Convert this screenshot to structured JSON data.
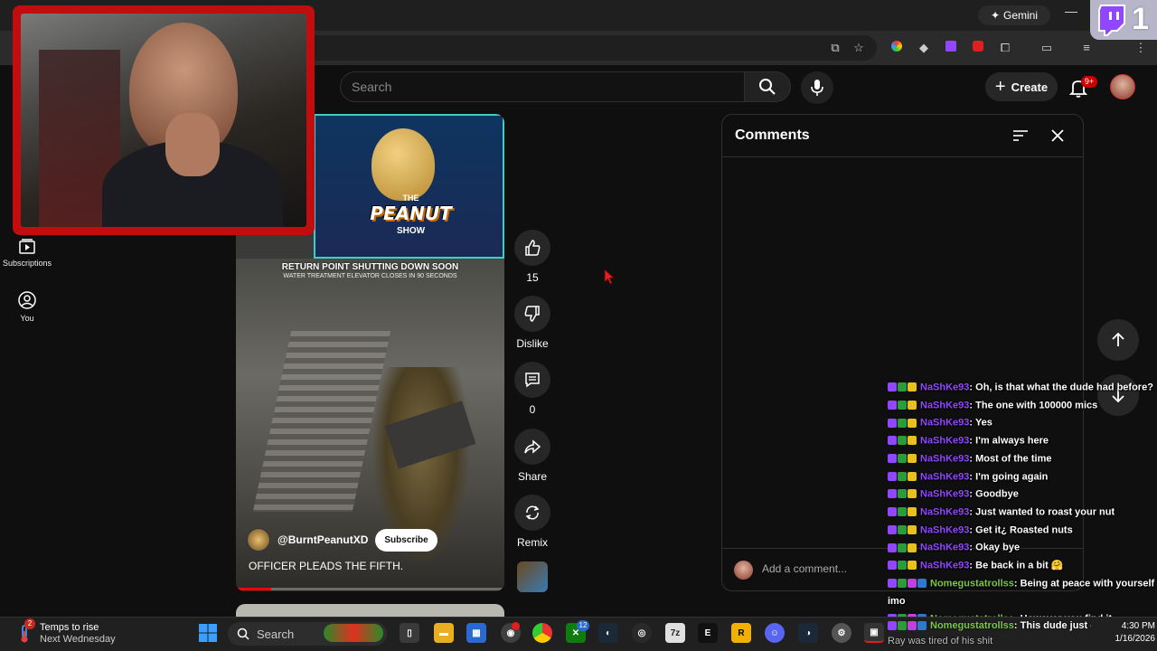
{
  "browser": {
    "gemini_label": "Gemini",
    "minimize_glyph": "—"
  },
  "twitch": {
    "viewer_count": "1"
  },
  "header": {
    "search_placeholder": "Search",
    "create_label": "Create",
    "notification_count": "9+"
  },
  "sidebar": {
    "items": [
      {
        "label": "Subscriptions",
        "icon": "subscriptions-icon"
      },
      {
        "label": "You",
        "icon": "user-icon"
      }
    ]
  },
  "video": {
    "show_top": "THE",
    "show_name": "PEANUT",
    "show_bottom": "SHOW",
    "hud_title": "RETURN POINT SHUTTING DOWN SOON",
    "hud_subtitle": "WATER TREATMENT ELEVATOR CLOSES IN 90 SECONDS",
    "channel": "@BurntPeanutXD",
    "subscribe_label": "Subscribe",
    "caption": "OFFICER PLEADS THE FIFTH.",
    "progress": 0.13
  },
  "actions": {
    "like_count": "15",
    "dislike_label": "Dislike",
    "comment_count": "0",
    "share_label": "Share",
    "remix_label": "Remix"
  },
  "comments": {
    "title": "Comments",
    "input_placeholder": "Add a comment..."
  },
  "chat": {
    "messages": [
      {
        "user": "NaShKe93",
        "text": ": Oh, is that what the dude had before?"
      },
      {
        "user": "NaShKe93",
        "text": ": The one with 100000 mics"
      },
      {
        "user": "NaShKe93",
        "text": ": Yes"
      },
      {
        "user": "NaShKe93",
        "text": ": I'm always here"
      },
      {
        "user": "NaShKe93",
        "text": ": Most of the time"
      },
      {
        "user": "NaShKe93",
        "text": ": I'm going again"
      },
      {
        "user": "NaShKe93",
        "text": ": Goodbye"
      },
      {
        "user": "NaShKe93",
        "text": ": Just wanted to roast your nut"
      },
      {
        "user": "NaShKe93",
        "text": ": Get it¿ Roasted nuts"
      },
      {
        "user": "NaShKe93",
        "text": ": Okay bye"
      },
      {
        "user": "NaShKe93",
        "text": ": Be back in a bit 🤗"
      },
      {
        "user": "Nomegustatrollss",
        "text": ": Being at peace with yourself imo"
      },
      {
        "user": "Nomegustatrollss",
        "text": ": However you find it"
      },
      {
        "user": "Nomegustatrollss",
        "text": ": This dude just down with"
      }
    ],
    "last_line": "Ray was tired of his shit"
  },
  "taskbar": {
    "weather_title": "Temps to rise",
    "weather_sub": "Next Wednesday",
    "weather_badge": "2",
    "search_label": "Search",
    "xbox_badge": "12",
    "time": "4:30 PM",
    "date": "1/16/2026"
  },
  "colors": {
    "twitch_purple": "#9147ff",
    "chat_green": "#7ac943",
    "webcam_border": "#c10d0d",
    "yt_red": "#ff0000"
  }
}
